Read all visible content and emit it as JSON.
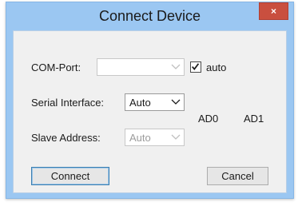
{
  "window": {
    "title": "Connect Device",
    "close_label": "×"
  },
  "com_port": {
    "label": "COM-Port:",
    "value": "",
    "enabled": false
  },
  "auto_checkbox": {
    "label": "auto",
    "checked": true
  },
  "serial_interface": {
    "label": "Serial Interface:",
    "value": "Auto",
    "enabled": true
  },
  "slave_address": {
    "label": "Slave Address:",
    "value": "Auto",
    "enabled": false
  },
  "pins": {
    "ad0": "AD0",
    "ad1": "AD1"
  },
  "buttons": {
    "connect": "Connect",
    "cancel": "Cancel"
  },
  "colors": {
    "title_bar": "#9bc7f2",
    "close_button": "#c94f3f",
    "dialog_background": "#f0f0f0",
    "default_button_border": "#3c7fb1"
  }
}
